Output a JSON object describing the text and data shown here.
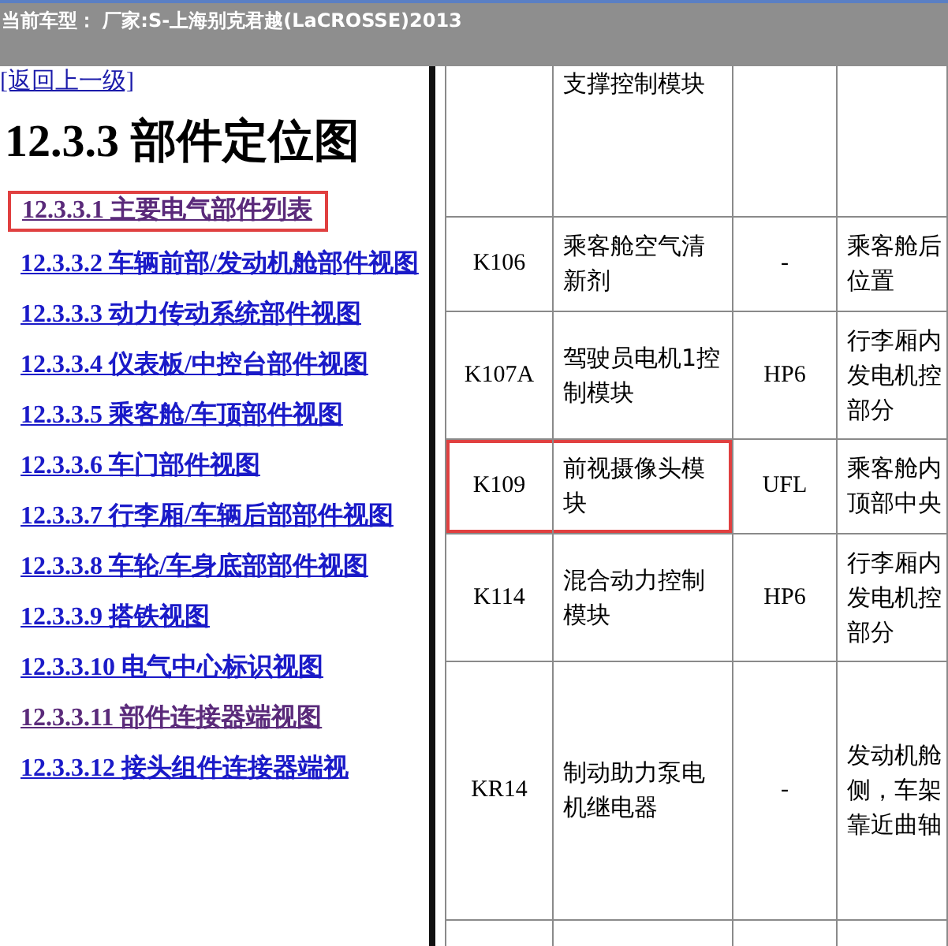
{
  "header": {
    "title": "当前车型： 厂家:S-上海别克君越(LaCROSSE)2013"
  },
  "nav": {
    "back_link": "[返回上一级]",
    "heading": "12.3.3 部件定位图",
    "links": [
      {
        "label": "12.3.3.1 主要电气部件列表",
        "visited": true,
        "highlighted": true
      },
      {
        "label": "12.3.3.2 车辆前部/发动机舱部件视图",
        "visited": false,
        "highlighted": false
      },
      {
        "label": "12.3.3.3 动力传动系统部件视图",
        "visited": false,
        "highlighted": false
      },
      {
        "label": "12.3.3.4 仪表板/中控台部件视图",
        "visited": false,
        "highlighted": false
      },
      {
        "label": "12.3.3.5 乘客舱/车顶部件视图",
        "visited": false,
        "highlighted": false
      },
      {
        "label": "12.3.3.6 车门部件视图",
        "visited": false,
        "highlighted": false
      },
      {
        "label": "12.3.3.7 行李厢/车辆后部部件视图",
        "visited": false,
        "highlighted": false
      },
      {
        "label": "12.3.3.8 车轮/车身底部部件视图",
        "visited": false,
        "highlighted": false
      },
      {
        "label": "12.3.3.9 搭铁视图",
        "visited": false,
        "highlighted": false
      },
      {
        "label": "12.3.3.10 电气中心标识视图",
        "visited": false,
        "highlighted": false
      },
      {
        "label": "12.3.3.11 部件连接器端视图",
        "visited": true,
        "highlighted": false
      },
      {
        "label": "12.3.3.12 接头组件连接器端视",
        "visited": false,
        "highlighted": false
      }
    ]
  },
  "table": {
    "rows": [
      {
        "code": "",
        "name": "支撑控制模块",
        "connector": "",
        "location": [],
        "highlighted": false
      },
      {
        "code": "K106",
        "name": "乘客舱空气清新剂",
        "connector": "-",
        "location": [
          "乘客舱后",
          "位置"
        ],
        "highlighted": false
      },
      {
        "code": "K107A",
        "name": "驾驶员电机1控制模块",
        "connector": "HP6",
        "location": [
          "行李厢内",
          "发电机控",
          "部分"
        ],
        "highlighted": false
      },
      {
        "code": "K109",
        "name": "前视摄像头模块",
        "connector": "UFL",
        "location": [
          "乘客舱内",
          "顶部中央"
        ],
        "highlighted": true
      },
      {
        "code": "K114",
        "name": "混合动力控制模块",
        "connector": "HP6",
        "location": [
          "行李厢内",
          "发电机控",
          "部分"
        ],
        "highlighted": false
      },
      {
        "code": "KR14",
        "name": "制动助力泵电机继电器",
        "connector": "-",
        "location": [
          "发动机舱",
          "侧，车架",
          "靠近曲轴"
        ],
        "highlighted": false
      }
    ]
  }
}
